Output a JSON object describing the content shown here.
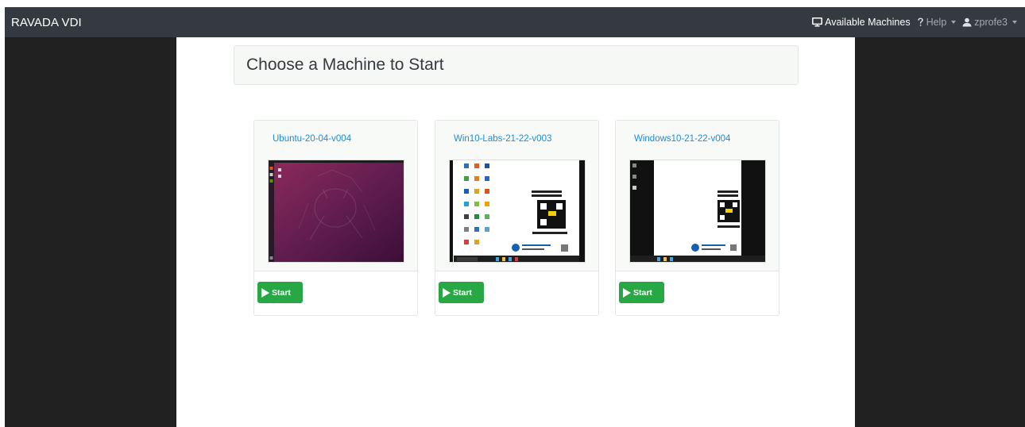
{
  "navbar": {
    "brand": "RAVADA VDI",
    "items": [
      {
        "label": "Available Machines",
        "icon": "desktop-icon"
      },
      {
        "label": "Help",
        "icon": "question-icon"
      },
      {
        "label": "zprofe3",
        "icon": "user-icon"
      }
    ]
  },
  "page": {
    "heading": "Choose a Machine to Start"
  },
  "machines": [
    {
      "name": "Ubuntu-20-04-v004",
      "screenshot": "ubuntu-desktop-screenshot",
      "button": "Start"
    },
    {
      "name": "Win10-Labs-21-22-v003",
      "screenshot": "windows-desktop-screenshot",
      "button": "Start"
    },
    {
      "name": "Windows10-21-22-v004",
      "screenshot": "windows-desktop-screenshot",
      "button": "Start"
    }
  ],
  "colors": {
    "navbar": "#343a40",
    "sidebar": "#212121",
    "link": "#1f8ae0",
    "start": "#28a745"
  }
}
